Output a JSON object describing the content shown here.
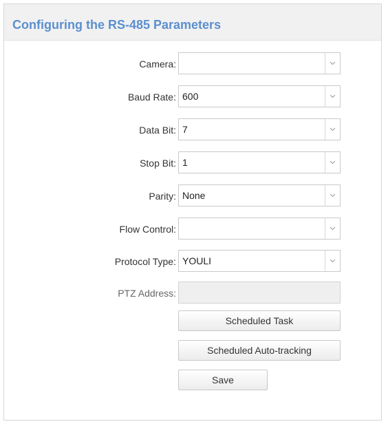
{
  "title": "Configuring the RS-485 Parameters",
  "fields": {
    "camera": {
      "label": "Camera:",
      "value": ""
    },
    "baud_rate": {
      "label": "Baud Rate:",
      "value": "600"
    },
    "data_bit": {
      "label": "Data Bit:",
      "value": "7"
    },
    "stop_bit": {
      "label": "Stop Bit:",
      "value": "1"
    },
    "parity": {
      "label": "Parity:",
      "value": "None"
    },
    "flow_control": {
      "label": "Flow Control:",
      "value": ""
    },
    "protocol_type": {
      "label": "Protocol Type:",
      "value": "YOULI"
    },
    "ptz_address": {
      "label": "PTZ Address:",
      "value": ""
    }
  },
  "buttons": {
    "scheduled_task": "Scheduled Task",
    "scheduled_auto_tracking": "Scheduled Auto-tracking",
    "save": "Save"
  },
  "icons": {
    "dropdown": "chevron-down-icon"
  },
  "colors": {
    "title": "#5b8fcf",
    "header_bg": "#f1f1f1",
    "disabled_field_bg": "#efefef"
  }
}
